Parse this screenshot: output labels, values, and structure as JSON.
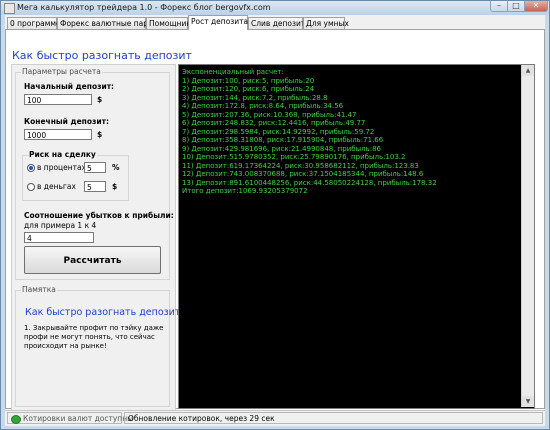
{
  "window": {
    "title": "Мега калькулятор трейдера 1.0 - Форекс блог bergovfx.com",
    "min_glyph": "–",
    "max_glyph": "□",
    "close_glyph": "✕"
  },
  "tabs": [
    "0 программе",
    "Форекс валютные пары",
    "Помощник",
    "Рост депозита",
    "Слив депозита",
    "Для умных"
  ],
  "page_title": "Как быстро разогнать депозит",
  "params": {
    "legend": "Параметры расчета",
    "start_label": "Начальный депозит:",
    "start_value": "100",
    "end_label": "Конечный депозит:",
    "end_value": "1000",
    "currency": "$",
    "risk_legend": "Риск на сделку",
    "risk_percent_label": "в процентах",
    "risk_percent_value": "5",
    "percent_sign": "%",
    "risk_money_label": "в деньгах",
    "risk_money_value": "5",
    "ratio_label": "Соотношение убытков к прибыли:",
    "ratio_hint": "для примера 1 к 4",
    "ratio_value": "4",
    "calc_button": "Рассчитать"
  },
  "memo": {
    "legend": "Памятка",
    "title": "Как быстро разогнать депозит:",
    "text": "1. Закрывайте профит по тэйку даже профи не могут понять, что сейчас происходит на рынке!"
  },
  "console_lines": [
    "Экспоненциальный расчет:",
    "1) Депозит:100, риск:5, прибыль:20",
    "2) Депозит:120, риск:6, прибыль:24",
    "3) Депозит:144, риск:7.2, прибыль:28.8",
    "4) Депозит:172.8, риск:8.64, прибыль:34.56",
    "5) Депозит:207.36, риск:10.368, прибыль:41.47",
    "6) Депозит:248.832, риск:12.4416, прибыль:49.77",
    "7) Депозит:298.5984, риск:14.92992, прибыль:59.72",
    "8) Депозит:358.31808, риск:17.915904, прибыль:71.66",
    "9) Депозит:429.981696, риск:21.4990848, прибыль:86",
    "10) Депозит:515.9780352, риск:25.79890176, прибыль:103.2",
    "11) Депозит:619.17364224, риск:30.958682112, прибыль:123.83",
    "12) Депозит:743.008370688, риск:37.1504185344, прибыль:148.6",
    "13) Депозит:891.6100448256, риск:44.58050224128, прибыль:178.32",
    "Итого депозит:1069.93205379072"
  ],
  "status": {
    "quotes": "Котировки валют доступны",
    "update": "Обновление котировок, через 29 сек"
  },
  "colors": {
    "accent": "#1f3fcf",
    "console_bg": "#000000",
    "console_text": "#3bd43b",
    "status_ok": "#35a53a"
  }
}
